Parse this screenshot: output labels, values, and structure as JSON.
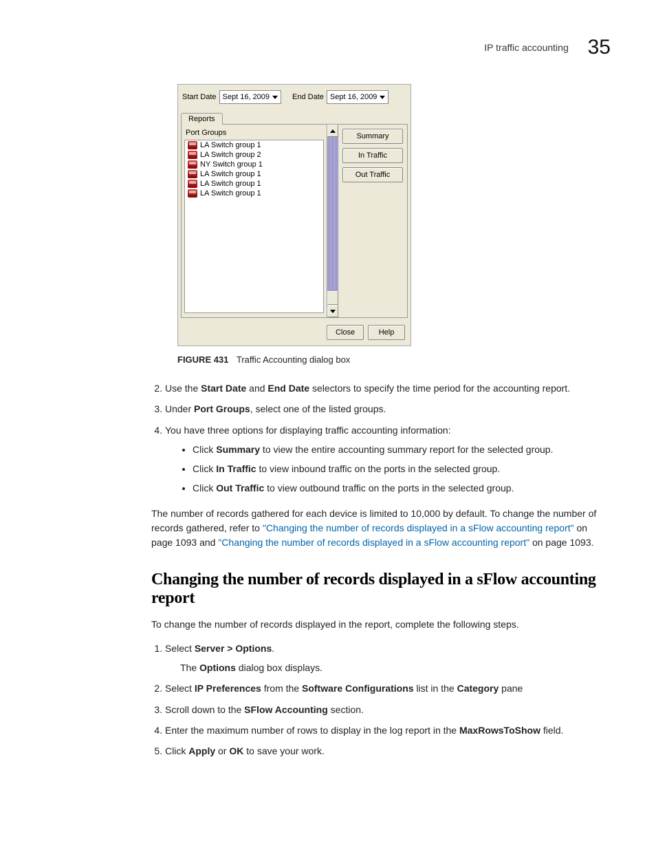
{
  "header": {
    "section_name": "IP traffic accounting",
    "page_number": "35"
  },
  "dialog": {
    "start_date_label": "Start Date",
    "end_date_label": "End Date",
    "start_date_value": "Sept 16, 2009",
    "end_date_value": "Sept 16, 2009",
    "tab_label": "Reports",
    "port_groups_header": "Port Groups",
    "port_groups": [
      "LA Switch group 1",
      "LA Switch group 2",
      "NY Switch group 1",
      "LA Switch group 1",
      "LA Switch group 1",
      "LA Switch group 1"
    ],
    "buttons": {
      "summary": "Summary",
      "in_traffic": "In Traffic",
      "out_traffic": "Out Traffic",
      "close": "Close",
      "help": "Help"
    }
  },
  "caption": {
    "label": "FIGURE 431",
    "text": "Traffic Accounting dialog box"
  },
  "steps_a": {
    "2_pre": "Use the ",
    "2_b1": "Start Date",
    "2_mid": " and ",
    "2_b2": "End Date",
    "2_post": " selectors to specify the time period for the accounting report.",
    "3_pre": "Under ",
    "3_b": "Port Groups",
    "3_post": ", select one of the listed groups.",
    "4": "You have three options for displaying traffic accounting information:"
  },
  "bullets": {
    "b1_pre": "Click ",
    "b1_b": "Summary",
    "b1_post": " to view the entire accounting summary report for the selected group.",
    "b2_pre": "Click ",
    "b2_b": "In Traffic",
    "b2_post": " to view inbound traffic on the ports in the selected group.",
    "b3_pre": "Click ",
    "b3_b": "Out Traffic",
    "b3_post": " to view outbound traffic on the ports in the selected group."
  },
  "para": {
    "p1": "The number of records gathered for each device is limited to 10,000 by default. To change the number of records gathered, refer to ",
    "link1": "\"Changing the number of records displayed in a sFlow accounting report\"",
    "p2": " on page 1093 and ",
    "link2": "\"Changing the number of records displayed in a sFlow accounting report\"",
    "p3": " on page 1093."
  },
  "section_heading": "Changing the number of records displayed in a sFlow accounting report",
  "sub_intro": "To change the number of records displayed in the report, complete the following steps.",
  "steps_b": {
    "1_pre": "Select ",
    "1_b": "Server > Options",
    "1_post": ".",
    "1_sub_pre": "The ",
    "1_sub_b": "Options",
    "1_sub_post": " dialog box displays.",
    "2_pre": "Select ",
    "2_b1": "IP Preferences",
    "2_mid": " from the ",
    "2_b2": "Software Configurations",
    "2_mid2": " list in the ",
    "2_b3": "Category",
    "2_post": " pane",
    "3_pre": "Scroll down to the ",
    "3_b": "SFlow Accounting",
    "3_post": " section.",
    "4_pre": "Enter the maximum number of rows to display in the log report in the ",
    "4_b": "MaxRowsToShow",
    "4_post": " field.",
    "5_pre": "Click ",
    "5_b1": "Apply",
    "5_mid": " or ",
    "5_b2": "OK",
    "5_post": " to save your work."
  }
}
